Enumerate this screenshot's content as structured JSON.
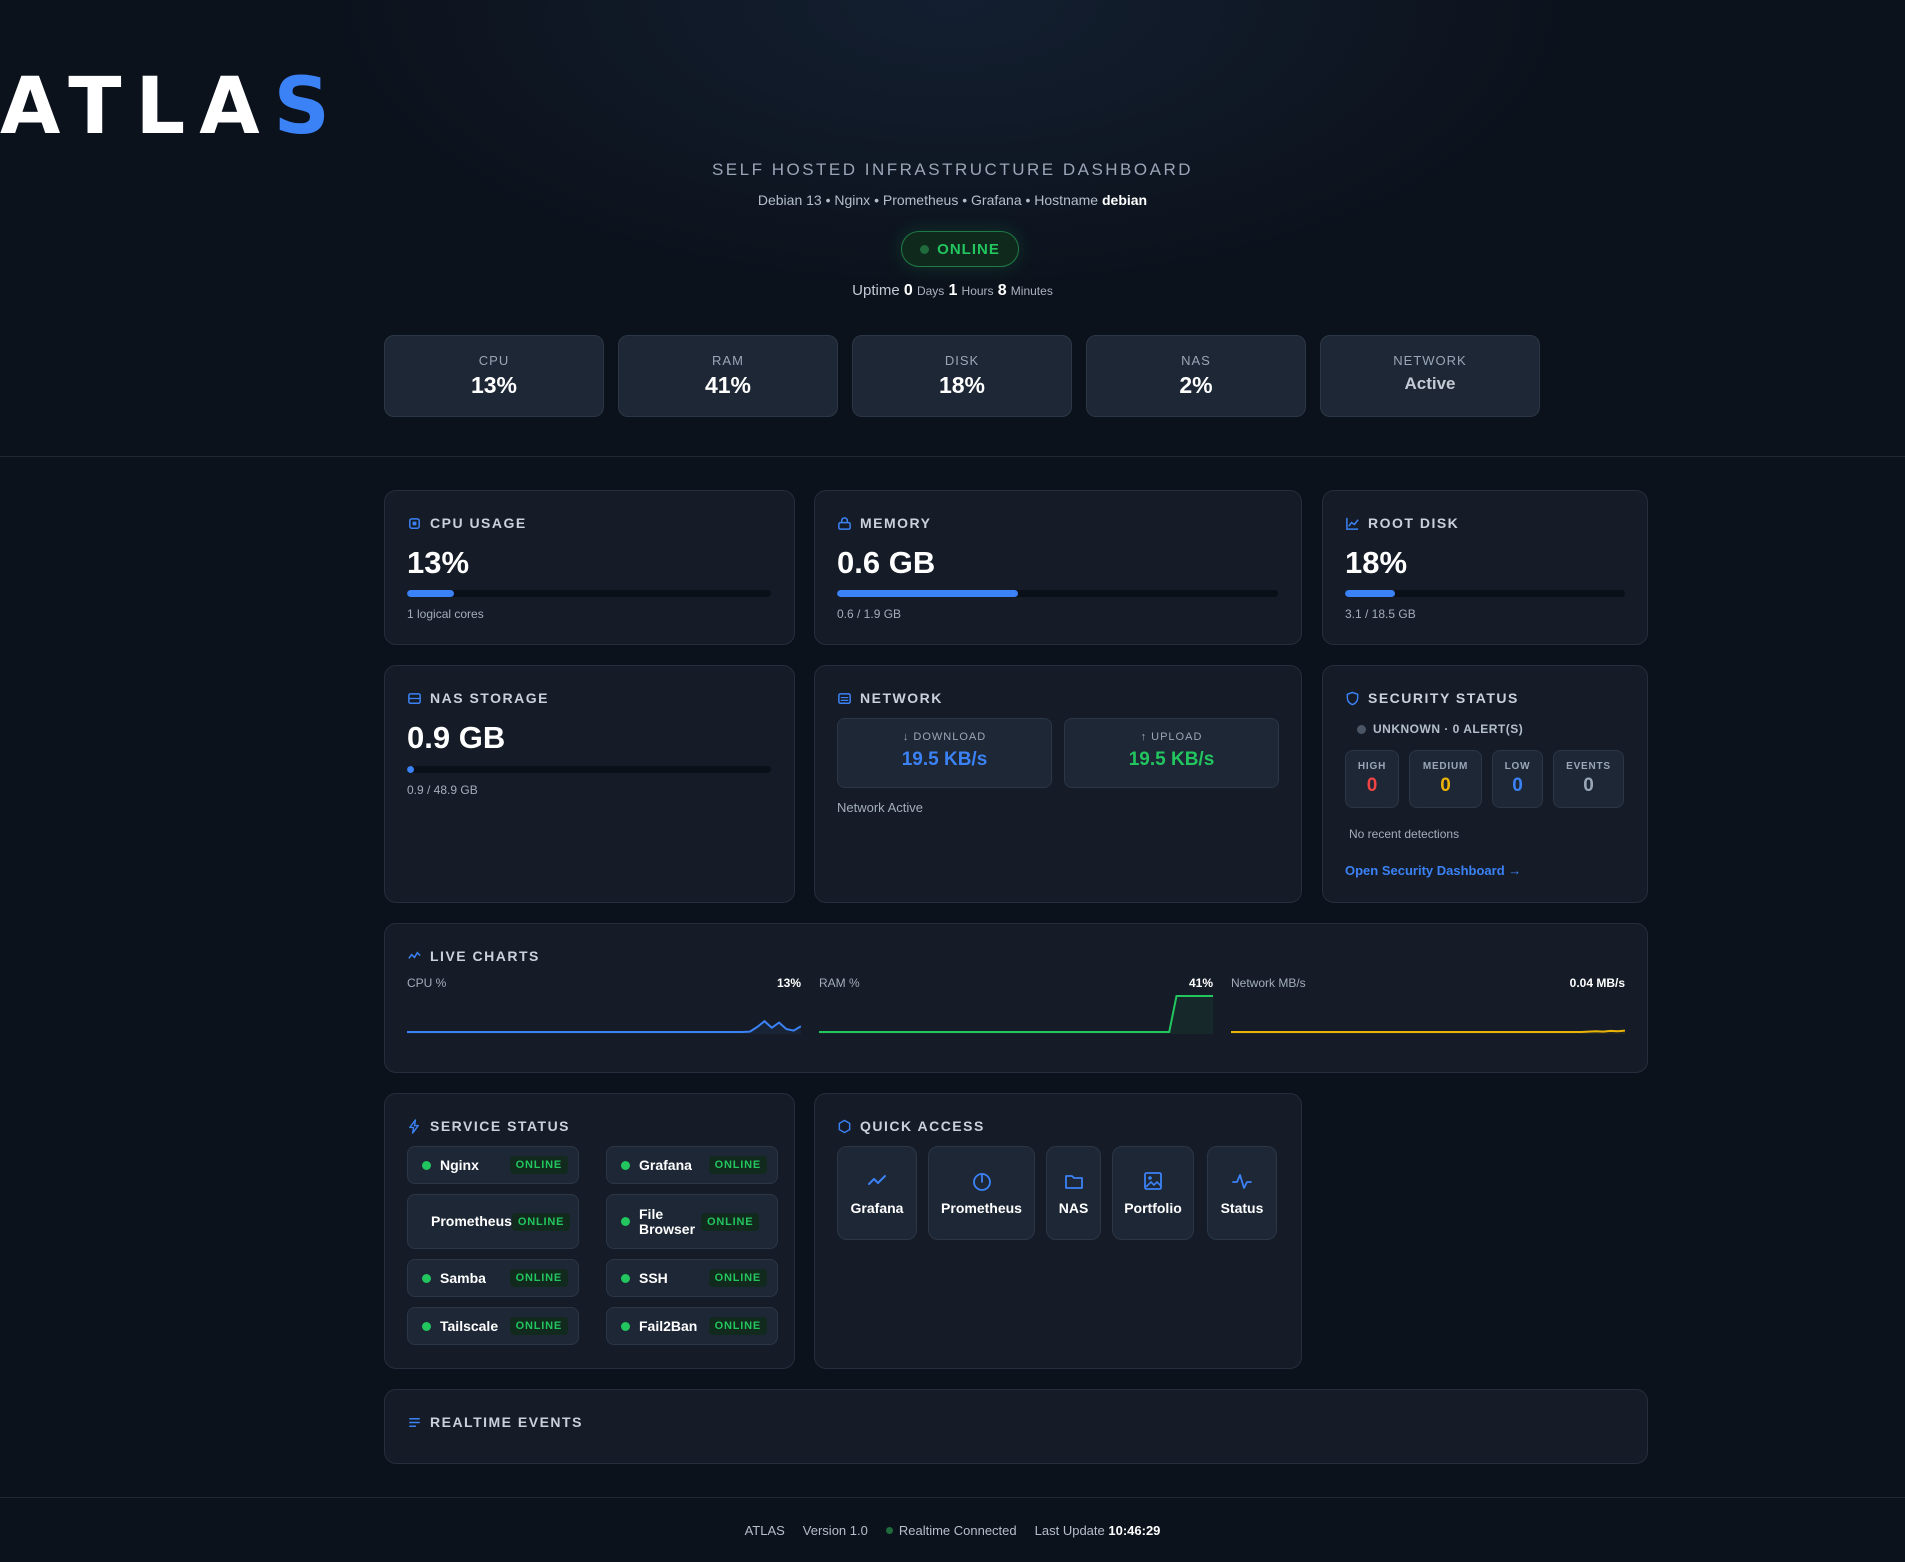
{
  "header": {
    "title_main": "ATLA",
    "title_accent": "S",
    "subtitle": "SELF HOSTED INFRASTRUCTURE DASHBOARD",
    "stack": "Debian 13 • Nginx • Prometheus • Grafana • Hostname",
    "hostname": "debian",
    "status": "ONLINE",
    "uptime": {
      "label": "Uptime",
      "days": "0",
      "days_label": "Days",
      "hours": "1",
      "hours_label": "Hours",
      "minutes": "8",
      "minutes_label": "Minutes"
    }
  },
  "summary_tiles": [
    {
      "label": "CPU",
      "value": "13%"
    },
    {
      "label": "RAM",
      "value": "41%"
    },
    {
      "label": "DISK",
      "value": "18%"
    },
    {
      "label": "NAS",
      "value": "2%"
    },
    {
      "label": "NETWORK",
      "value": "Active"
    }
  ],
  "cpu_card": {
    "title": "CPU USAGE",
    "value": "13%",
    "percent": 13,
    "note": "1 logical cores"
  },
  "memory_card": {
    "title": "MEMORY",
    "value": "0.6 GB",
    "percent": 41,
    "note": "0.6 / 1.9 GB"
  },
  "disk_card": {
    "title": "ROOT DISK",
    "value": "18%",
    "percent": 18,
    "note": "3.1 / 18.5 GB"
  },
  "nas_card": {
    "title": "NAS STORAGE",
    "value": "0.9 GB",
    "percent": 2,
    "note": "0.9 / 48.9 GB"
  },
  "network_card": {
    "title": "NETWORK",
    "download_label": "↓ DOWNLOAD",
    "download_value": "19.5 KB/s",
    "upload_label": "↑ UPLOAD",
    "upload_value": "19.5 KB/s",
    "note": "Network Active"
  },
  "security_card": {
    "title": "SECURITY STATUS",
    "status_line": "UNKNOWN · 0 ALERT(S)",
    "levels": [
      {
        "label": "HIGH",
        "value": "0",
        "color": "#ef4444"
      },
      {
        "label": "MEDIUM",
        "value": "0",
        "color": "#eab308"
      },
      {
        "label": "LOW",
        "value": "0",
        "color": "#3b82f6"
      },
      {
        "label": "EVENTS",
        "value": "0",
        "color": "#9aa6b8"
      }
    ],
    "note": "No recent detections",
    "link": "Open Security Dashboard →"
  },
  "live_charts": {
    "title": "LIVE CHARTS",
    "charts": [
      {
        "label": "CPU %",
        "current": "13%",
        "color": "#3b82f6"
      },
      {
        "label": "RAM %",
        "current": "41%",
        "color": "#22c55e"
      },
      {
        "label": "Network MB/s",
        "current": "0.04 MB/s",
        "color": "#eab308"
      }
    ]
  },
  "chart_data": [
    {
      "type": "line",
      "series": [
        {
          "values": [
            0,
            0,
            0,
            0,
            0,
            0,
            0,
            0,
            0,
            0,
            0,
            0,
            0,
            0,
            0,
            0,
            0,
            0,
            0,
            0,
            0,
            0,
            0,
            0,
            0,
            0,
            0,
            0,
            0,
            0,
            0,
            0,
            0,
            0,
            0,
            0,
            0,
            0,
            0,
            0,
            0,
            0,
            0,
            0,
            0,
            0,
            0,
            1,
            14,
            30,
            12,
            26,
            8,
            4,
            16
          ]
        }
      ],
      "ylim": [
        0,
        100
      ]
    },
    {
      "type": "line",
      "series": [
        {
          "values": [
            0,
            0,
            0,
            0,
            0,
            0,
            0,
            0,
            0,
            0,
            0,
            0,
            0,
            0,
            0,
            0,
            0,
            0,
            0,
            0,
            0,
            0,
            0,
            0,
            0,
            0,
            0,
            0,
            0,
            0,
            0,
            0,
            0,
            0,
            0,
            0,
            0,
            0,
            0,
            0,
            0,
            0,
            0,
            0,
            0,
            0,
            0,
            0,
            0,
            41,
            41,
            41,
            41,
            41,
            41
          ]
        }
      ],
      "ylim": [
        0,
        41
      ]
    },
    {
      "type": "line",
      "series": [
        {
          "values": [
            0,
            0,
            0,
            0,
            0,
            0,
            0,
            0,
            0,
            0,
            0,
            0,
            0,
            0,
            0,
            0,
            0,
            0,
            0,
            0,
            0,
            0,
            0,
            0,
            0,
            0,
            0,
            0,
            0,
            0,
            0,
            0,
            0,
            0,
            0,
            0,
            0,
            0,
            0,
            0,
            0,
            0,
            0,
            0,
            0,
            0,
            0,
            0,
            0,
            0.01,
            0.02,
            0.01,
            0.03,
            0.02,
            0.04
          ]
        }
      ],
      "ylim": [
        0,
        1
      ]
    }
  ],
  "services": {
    "title": "SERVICE STATUS",
    "items": [
      {
        "name": "Nginx",
        "status": "ONLINE"
      },
      {
        "name": "Grafana",
        "status": "ONLINE"
      },
      {
        "name": "Prometheus",
        "status": "ONLINE"
      },
      {
        "name": "File Browser",
        "status": "ONLINE"
      },
      {
        "name": "Samba",
        "status": "ONLINE"
      },
      {
        "name": "SSH",
        "status": "ONLINE"
      },
      {
        "name": "Tailscale",
        "status": "ONLINE"
      },
      {
        "name": "Fail2Ban",
        "status": "ONLINE"
      }
    ]
  },
  "quick_access": {
    "title": "QUICK ACCESS",
    "items": [
      {
        "label": "Grafana",
        "icon": "trend-icon"
      },
      {
        "label": "Prometheus",
        "icon": "power-icon"
      },
      {
        "label": "NAS",
        "icon": "folder-icon"
      },
      {
        "label": "Portfolio",
        "icon": "image-icon"
      },
      {
        "label": "Status",
        "icon": "pulse-icon"
      }
    ]
  },
  "events": {
    "title": "REALTIME EVENTS"
  },
  "footer": {
    "app": "ATLAS",
    "version": "Version 1.0",
    "connection": "Realtime Connected",
    "last_update_label": "Last Update",
    "last_update": "10:46:29"
  },
  "colors": {
    "accent": "#3b82f6",
    "success": "#22c55e",
    "warning": "#eab308",
    "danger": "#ef4444"
  }
}
